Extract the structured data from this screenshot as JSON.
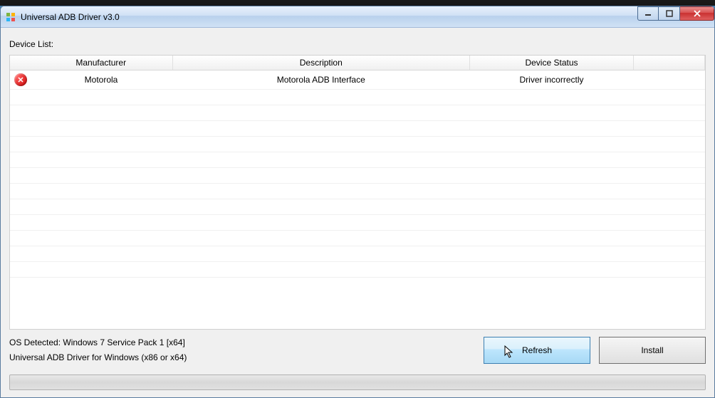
{
  "window": {
    "title": "Universal ADB Driver v3.0"
  },
  "labels": {
    "device_list": "Device List:"
  },
  "table": {
    "headers": {
      "manufacturer": "Manufacturer",
      "description": "Description",
      "device_status": "Device Status"
    },
    "rows": [
      {
        "status_icon": "error",
        "manufacturer": "Motorola",
        "description": "Motorola ADB Interface",
        "device_status": "Driver incorrectly"
      }
    ]
  },
  "footer": {
    "os_detected": "OS Detected: Windows 7 Service Pack 1 [x64]",
    "driver_info": "Universal ADB Driver for Windows (x86 or x64)"
  },
  "buttons": {
    "refresh": "Refresh",
    "install": "Install"
  }
}
